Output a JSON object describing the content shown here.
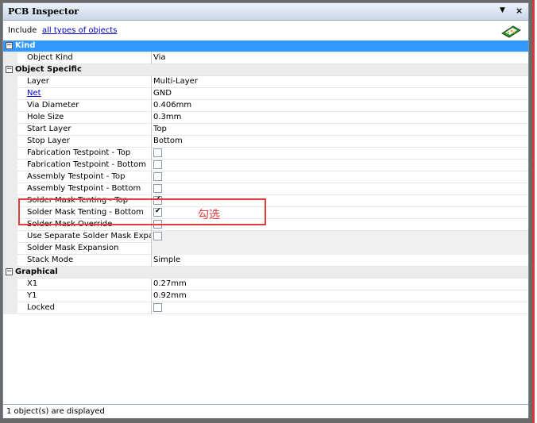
{
  "window": {
    "title": "PCB Inspector",
    "pin_icon": "▼",
    "close_icon": "×"
  },
  "include": {
    "label": "Include",
    "link": "all types of objects"
  },
  "categories": {
    "kind": "Kind",
    "object_specific": "Object Specific",
    "graphical": "Graphical"
  },
  "kind_rows": [
    {
      "name": "Object Kind",
      "value": "Via"
    }
  ],
  "specific": {
    "layer": {
      "name": "Layer",
      "value": "Multi-Layer"
    },
    "net": {
      "name": "Net",
      "value": "GND"
    },
    "via_diameter": {
      "name": "Via Diameter",
      "value": "0.406mm"
    },
    "hole_size": {
      "name": "Hole Size",
      "value": "0.3mm"
    },
    "start_layer": {
      "name": "Start Layer",
      "value": "Top"
    },
    "stop_layer": {
      "name": "Stop Layer",
      "value": "Bottom"
    },
    "fab_top": {
      "name": "Fabrication Testpoint - Top",
      "checked": false
    },
    "fab_bottom": {
      "name": "Fabrication Testpoint - Bottom",
      "checked": false
    },
    "asm_top": {
      "name": "Assembly Testpoint - Top",
      "checked": false
    },
    "asm_bottom": {
      "name": "Assembly Testpoint - Bottom",
      "checked": false
    },
    "smt_top": {
      "name": "Solder Mask Tenting - Top",
      "checked": true
    },
    "smt_bottom": {
      "name": "Solder Mask Tenting - Bottom",
      "checked": true
    },
    "sm_override": {
      "name": "Solder Mask Override",
      "checked": false
    },
    "sep_expansion": {
      "name": "Use Separate Solder Mask Expan...",
      "checked": false
    },
    "sm_expansion": {
      "name": "Solder Mask Expansion",
      "value": ""
    },
    "stack_mode": {
      "name": "Stack Mode",
      "value": "Simple"
    }
  },
  "graphical": {
    "x1": {
      "name": "X1",
      "value": "0.27mm"
    },
    "y1": {
      "name": "Y1",
      "value": "0.92mm"
    },
    "locked": {
      "name": "Locked",
      "checked": false
    }
  },
  "annotation": {
    "text": "勾选"
  },
  "status": "1 object(s) are displayed",
  "colors": {
    "kind_header": "#3399ff",
    "annotation": "#e23b3b",
    "link": "#0000cc"
  }
}
